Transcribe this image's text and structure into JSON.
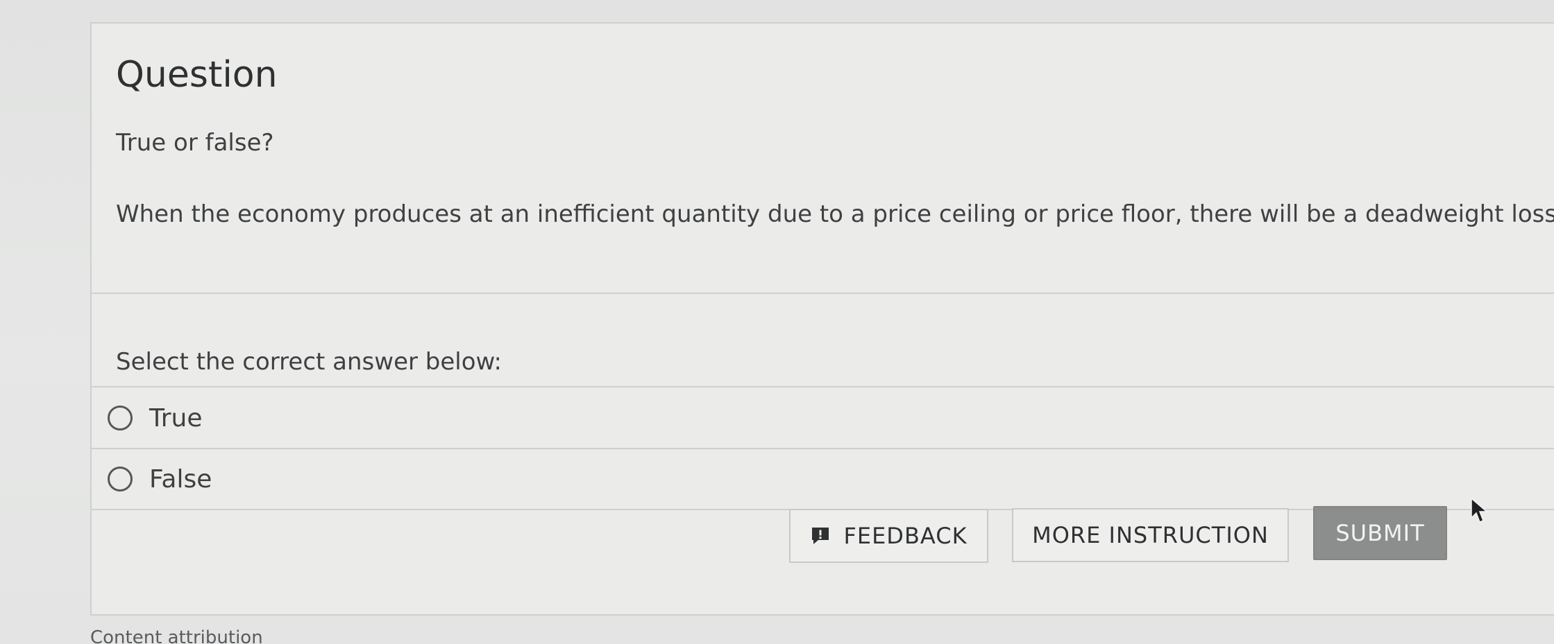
{
  "question": {
    "heading": "Question",
    "prompt": "True or false?",
    "stem": "When the economy produces at an inefficient quantity due to a price ceiling or price floor, there will be a deadweight loss."
  },
  "answers": {
    "instruction": "Select the correct answer below:",
    "options": [
      {
        "label": "True",
        "selected": false
      },
      {
        "label": "False",
        "selected": false
      }
    ]
  },
  "actions": {
    "feedback_label": "FEEDBACK",
    "feedback_icon": "exclamation-speech-bubble-icon",
    "more_instruction_label": "MORE INSTRUCTION",
    "submit_label": "SUBMIT"
  },
  "footer": {
    "attribution": "Content attribution"
  },
  "colors": {
    "card_background": "#ebecea",
    "submit_background": "#8c8d8d",
    "text": "#3f4042"
  }
}
